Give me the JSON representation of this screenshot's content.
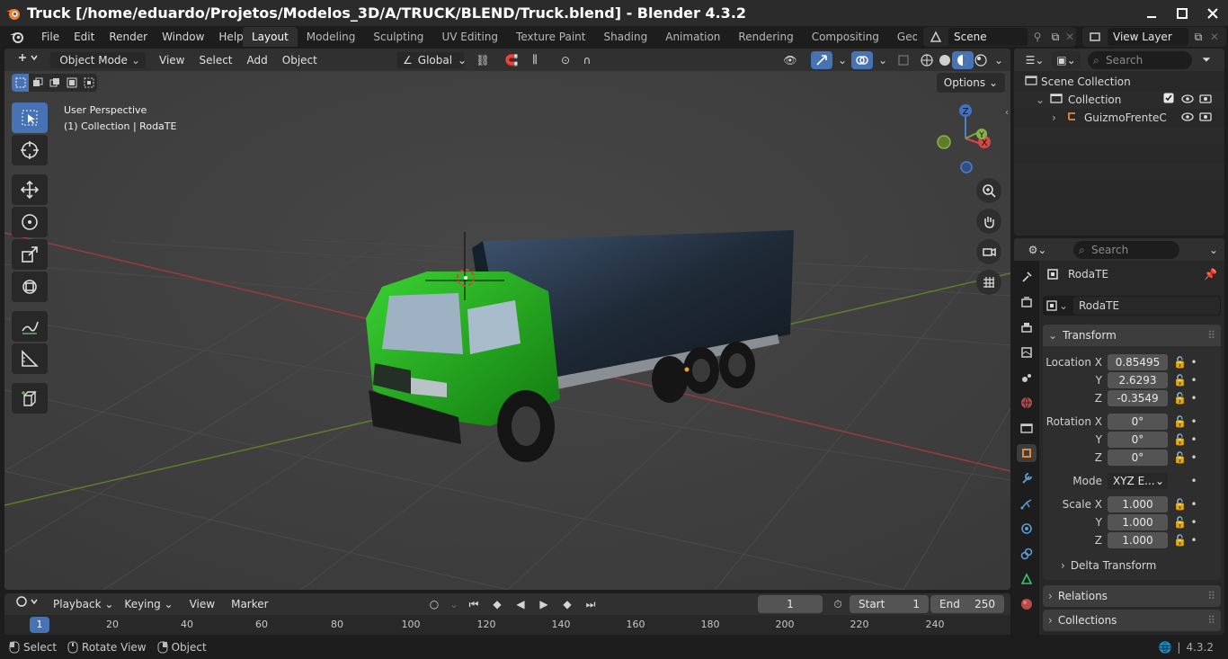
{
  "window": {
    "title": "Truck [/home/eduardo/Projetos/Modelos_3D/A/TRUCK/BLEND/Truck.blend] - Blender 4.3.2"
  },
  "menu": [
    "File",
    "Edit",
    "Render",
    "Window",
    "Help"
  ],
  "workspaces": [
    "Layout",
    "Modeling",
    "Sculpting",
    "UV Editing",
    "Texture Paint",
    "Shading",
    "Animation",
    "Rendering",
    "Compositing",
    "Geometry Noc"
  ],
  "active_workspace": "Layout",
  "scene": {
    "name": "Scene"
  },
  "view_layer": {
    "name": "View Layer"
  },
  "viewport": {
    "mode": "Object Mode",
    "menus": [
      "View",
      "Select",
      "Add",
      "Object"
    ],
    "transform_orientation": "Global",
    "perspective_label": "User Perspective",
    "collection_label": "(1) Collection | RodaTE",
    "options_label": "Options",
    "gizmo": {
      "x": "X",
      "y": "Y",
      "z": "Z"
    }
  },
  "timeline": {
    "playback": "Playback",
    "keying": "Keying",
    "view": "View",
    "marker": "Marker",
    "current_frame": "1",
    "start_label": "Start",
    "start": "1",
    "end_label": "End",
    "end": "250",
    "ticks": [
      "1",
      "20",
      "40",
      "60",
      "80",
      "100",
      "120",
      "140",
      "160",
      "180",
      "200",
      "220",
      "240"
    ]
  },
  "status": {
    "select": "Select",
    "rotate": "Rotate View",
    "object": "Object",
    "version": "4.3.2"
  },
  "outliner": {
    "search_placeholder": "Search",
    "scene_collection": "Scene Collection",
    "collection": "Collection",
    "item": "GuizmoFrenteC"
  },
  "properties": {
    "search_placeholder": "Search",
    "object_name": "RodaTE",
    "object_field": "RodaTE",
    "transform_label": "Transform",
    "location": {
      "label": "Location X",
      "x": "0.85495",
      "y": "2.6293",
      "z": "-0.3549"
    },
    "rotation": {
      "label": "Rotation X",
      "x": "0°",
      "y": "0°",
      "z": "0°"
    },
    "mode_label": "Mode",
    "mode_value": "XYZ E...",
    "scale": {
      "label": "Scale X",
      "x": "1.000",
      "y": "1.000",
      "z": "1.000"
    },
    "axis_y": "Y",
    "axis_z": "Z",
    "delta_transform": "Delta Transform",
    "relations": "Relations",
    "collections": "Collections"
  },
  "colors": {
    "accent": "#4772b3",
    "truck_cab": "#1ea317",
    "truck_box": "#1c2530",
    "axis_red": "#b83b3b",
    "axis_green": "#6c8c28"
  }
}
